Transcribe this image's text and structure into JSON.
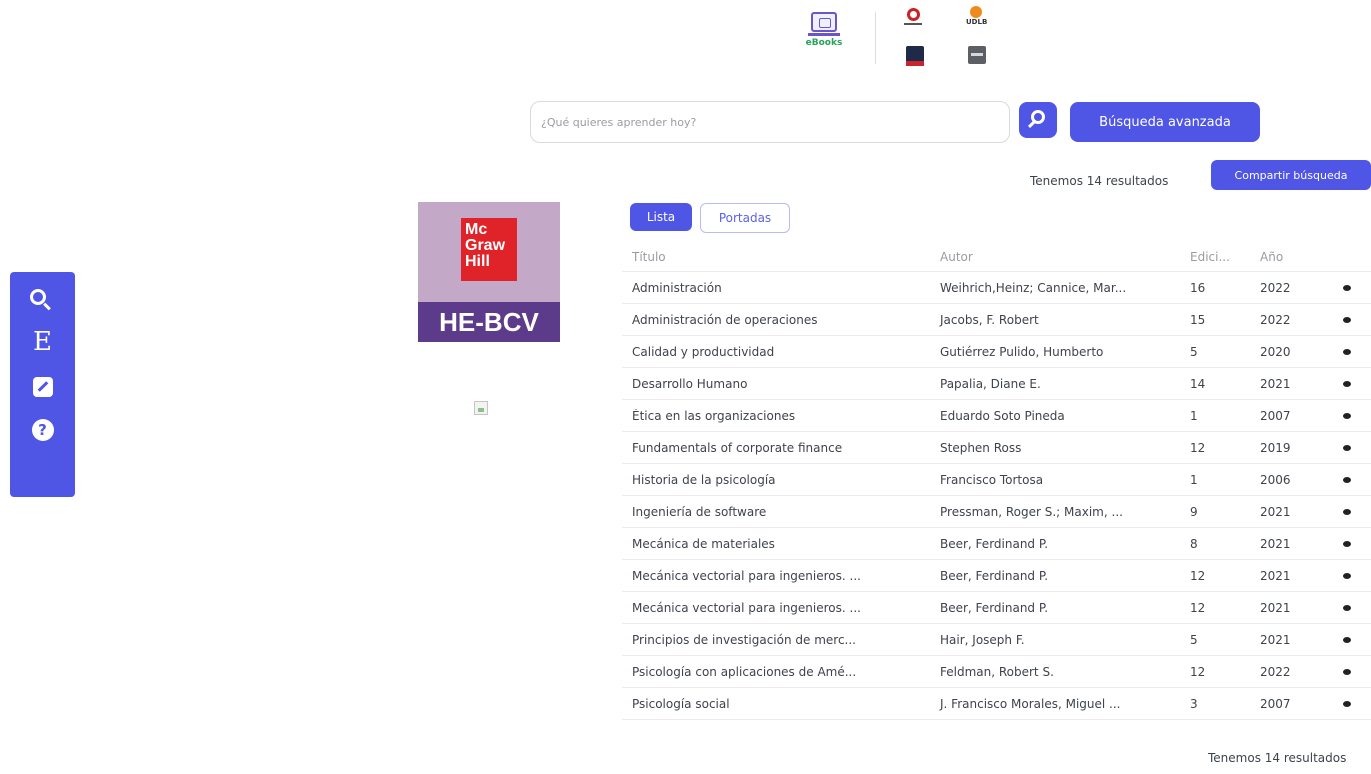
{
  "header": {
    "ebooks_logo_text": "eBooks",
    "partner_logos": [
      {
        "icon": "red-ring-logo-icon"
      },
      {
        "icon": "orange-dot-logo-icon",
        "text": "UDLB"
      },
      {
        "icon": "dark-blue-logo-icon"
      },
      {
        "icon": "gray-logo-icon"
      }
    ]
  },
  "search": {
    "placeholder": "¿Qué quieres aprender hoy?",
    "value": "",
    "advanced_label": "Búsqueda avanzada",
    "share_label": "Compartir búsqueda",
    "results_text": "Tenemos 14 resultados"
  },
  "sidebar": {
    "items": [
      {
        "icon": "search-icon"
      },
      {
        "icon": "e-letter-icon",
        "text": "E"
      },
      {
        "icon": "edit-icon"
      },
      {
        "icon": "help-icon",
        "text": "?"
      }
    ]
  },
  "collection": {
    "brand_lines": [
      "Mc",
      "Graw",
      "Hill"
    ],
    "name": "HE-BCV"
  },
  "view": {
    "list_label": "Lista",
    "covers_label": "Portadas",
    "active": "Lista"
  },
  "table": {
    "headers": {
      "title": "Título",
      "author": "Autor",
      "edition": "Edici...",
      "year": "Año"
    },
    "rows": [
      {
        "title": "Administración",
        "author": "Weihrich,Heinz; Cannice, Mar...",
        "edition": "16",
        "year": "2022"
      },
      {
        "title": "Administración de operaciones",
        "author": "Jacobs, F. Robert",
        "edition": "15",
        "year": "2022"
      },
      {
        "title": "Calidad y productividad",
        "author": "Gutiérrez Pulido, Humberto",
        "edition": "5",
        "year": "2020"
      },
      {
        "title": "Desarrollo Humano",
        "author": "Papalia, Diane E.",
        "edition": "14",
        "year": "2021"
      },
      {
        "title": "Ética en las organizaciones",
        "author": "Eduardo Soto Pineda",
        "edition": "1",
        "year": "2007"
      },
      {
        "title": "Fundamentals of corporate finance",
        "author": "Stephen Ross",
        "edition": "12",
        "year": "2019"
      },
      {
        "title": "Historia de la psicología",
        "author": "Francisco Tortosa",
        "edition": "1",
        "year": "2006"
      },
      {
        "title": "Ingeniería de software",
        "author": "Pressman, Roger S.; Maxim, ...",
        "edition": "9",
        "year": "2021"
      },
      {
        "title": "Mecánica de materiales",
        "author": "Beer, Ferdinand P.",
        "edition": "8",
        "year": "2021"
      },
      {
        "title": "Mecánica vectorial para ingenieros. ...",
        "author": "Beer, Ferdinand P.",
        "edition": "12",
        "year": "2021"
      },
      {
        "title": "Mecánica vectorial para ingenieros. ...",
        "author": "Beer, Ferdinand P.",
        "edition": "12",
        "year": "2021"
      },
      {
        "title": "Principios de investigación de merc...",
        "author": "Hair, Joseph F.",
        "edition": "5",
        "year": "2021"
      },
      {
        "title": "Psicología con aplicaciones de Amé...",
        "author": "Feldman, Robert S.",
        "edition": "12",
        "year": "2022"
      },
      {
        "title": "Psicología social",
        "author": "J. Francisco Morales, Miguel ...",
        "edition": "3",
        "year": "2007"
      }
    ],
    "row_action_icon": "eye-icon"
  },
  "colors": {
    "accent": "#4f56e6",
    "brand_red": "#df2329",
    "brand_purple": "#5c3b8a"
  }
}
